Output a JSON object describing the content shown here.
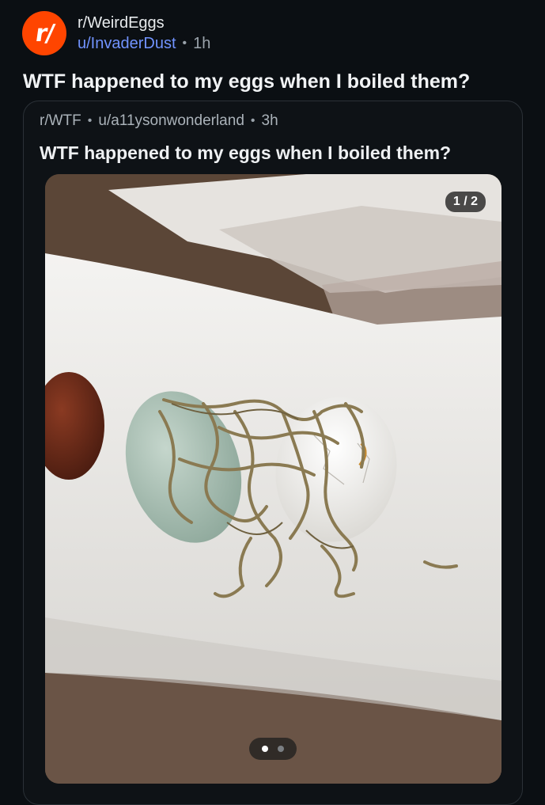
{
  "post": {
    "subreddit": "r/WeirdEggs",
    "author": "u/InvaderDust",
    "separator": "•",
    "age": "1h",
    "title": "WTF happened to my eggs when I boiled them?"
  },
  "crosspost": {
    "subreddit": "r/WTF",
    "author": "u/a11ysonwonderland",
    "separator": "•",
    "age": "3h",
    "title": "WTF happened to my eggs when I boiled them?",
    "gallery": {
      "counter": "1 / 2",
      "current": 1,
      "total": 2
    }
  },
  "colors": {
    "background": "#0b0f13",
    "brand": "#ff4500",
    "link": "#7193ff",
    "muted": "#9aa3ab"
  },
  "icons": {
    "avatar": "reddit-r-slash-logo"
  }
}
